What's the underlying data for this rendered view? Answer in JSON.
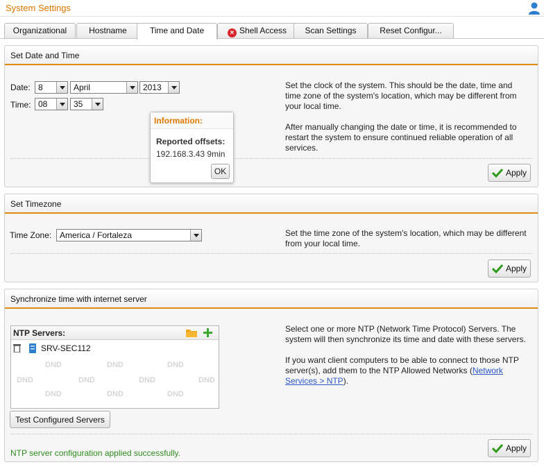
{
  "app": {
    "title": "System Settings"
  },
  "tabs": [
    {
      "label": "Organizational"
    },
    {
      "label": "Hostname"
    },
    {
      "label": "Time and Date"
    },
    {
      "label": "Shell Access"
    },
    {
      "label": "Scan Settings"
    },
    {
      "label": "Reset Configur..."
    }
  ],
  "date_time": {
    "header": "Set Date and Time",
    "date_label": "Date:",
    "day": "8",
    "month": "April",
    "year": "2013",
    "time_label": "Time:",
    "hour": "08",
    "minute": "35",
    "desc_p1": "Set the clock of the system. This should be the date, time and time zone of the system's location, which may be different from your local time.",
    "desc_p2": "After manually changing the date or time, it is recommended to restart the system to ensure continued reliable operation of all services.",
    "apply_label": "Apply"
  },
  "info_popup": {
    "title": "Information:",
    "heading": "Reported offsets:",
    "entry": "192.168.3.43 9min",
    "ok_label": "OK"
  },
  "timezone": {
    "header": "Set Timezone",
    "label": "Time Zone:",
    "value": "America / Fortaleza",
    "desc": "Set the time zone of the system's location, which may be different from your local time.",
    "apply_label": "Apply"
  },
  "sync": {
    "header": "Synchronize time with internet server",
    "ntp_label": "NTP Servers:",
    "servers": [
      "SRV-SEC112"
    ],
    "watermark": "DND",
    "desc_p1": "Select one or more NTP (Network Time Protocol) Servers. The system will then synchronize its time and date with these servers.",
    "desc_p2_pre": "If you want client computers to be able to connect to those NTP server(s), add them to the NTP Allowed Networks (",
    "desc_p2_link": "Network Services > NTP",
    "desc_p2_post": ").",
    "test_label": "Test Configured Servers",
    "apply_label": "Apply",
    "status": "NTP server configuration applied successfully."
  },
  "colors": {
    "accent": "#e08a12",
    "title_orange": "#e07800",
    "success_green": "#2e8b1e",
    "link_blue": "#2a56c6"
  },
  "icons": [
    "user-icon",
    "error-icon",
    "checkmark-icon",
    "folder-icon",
    "add-icon",
    "trash-icon",
    "server-icon"
  ]
}
